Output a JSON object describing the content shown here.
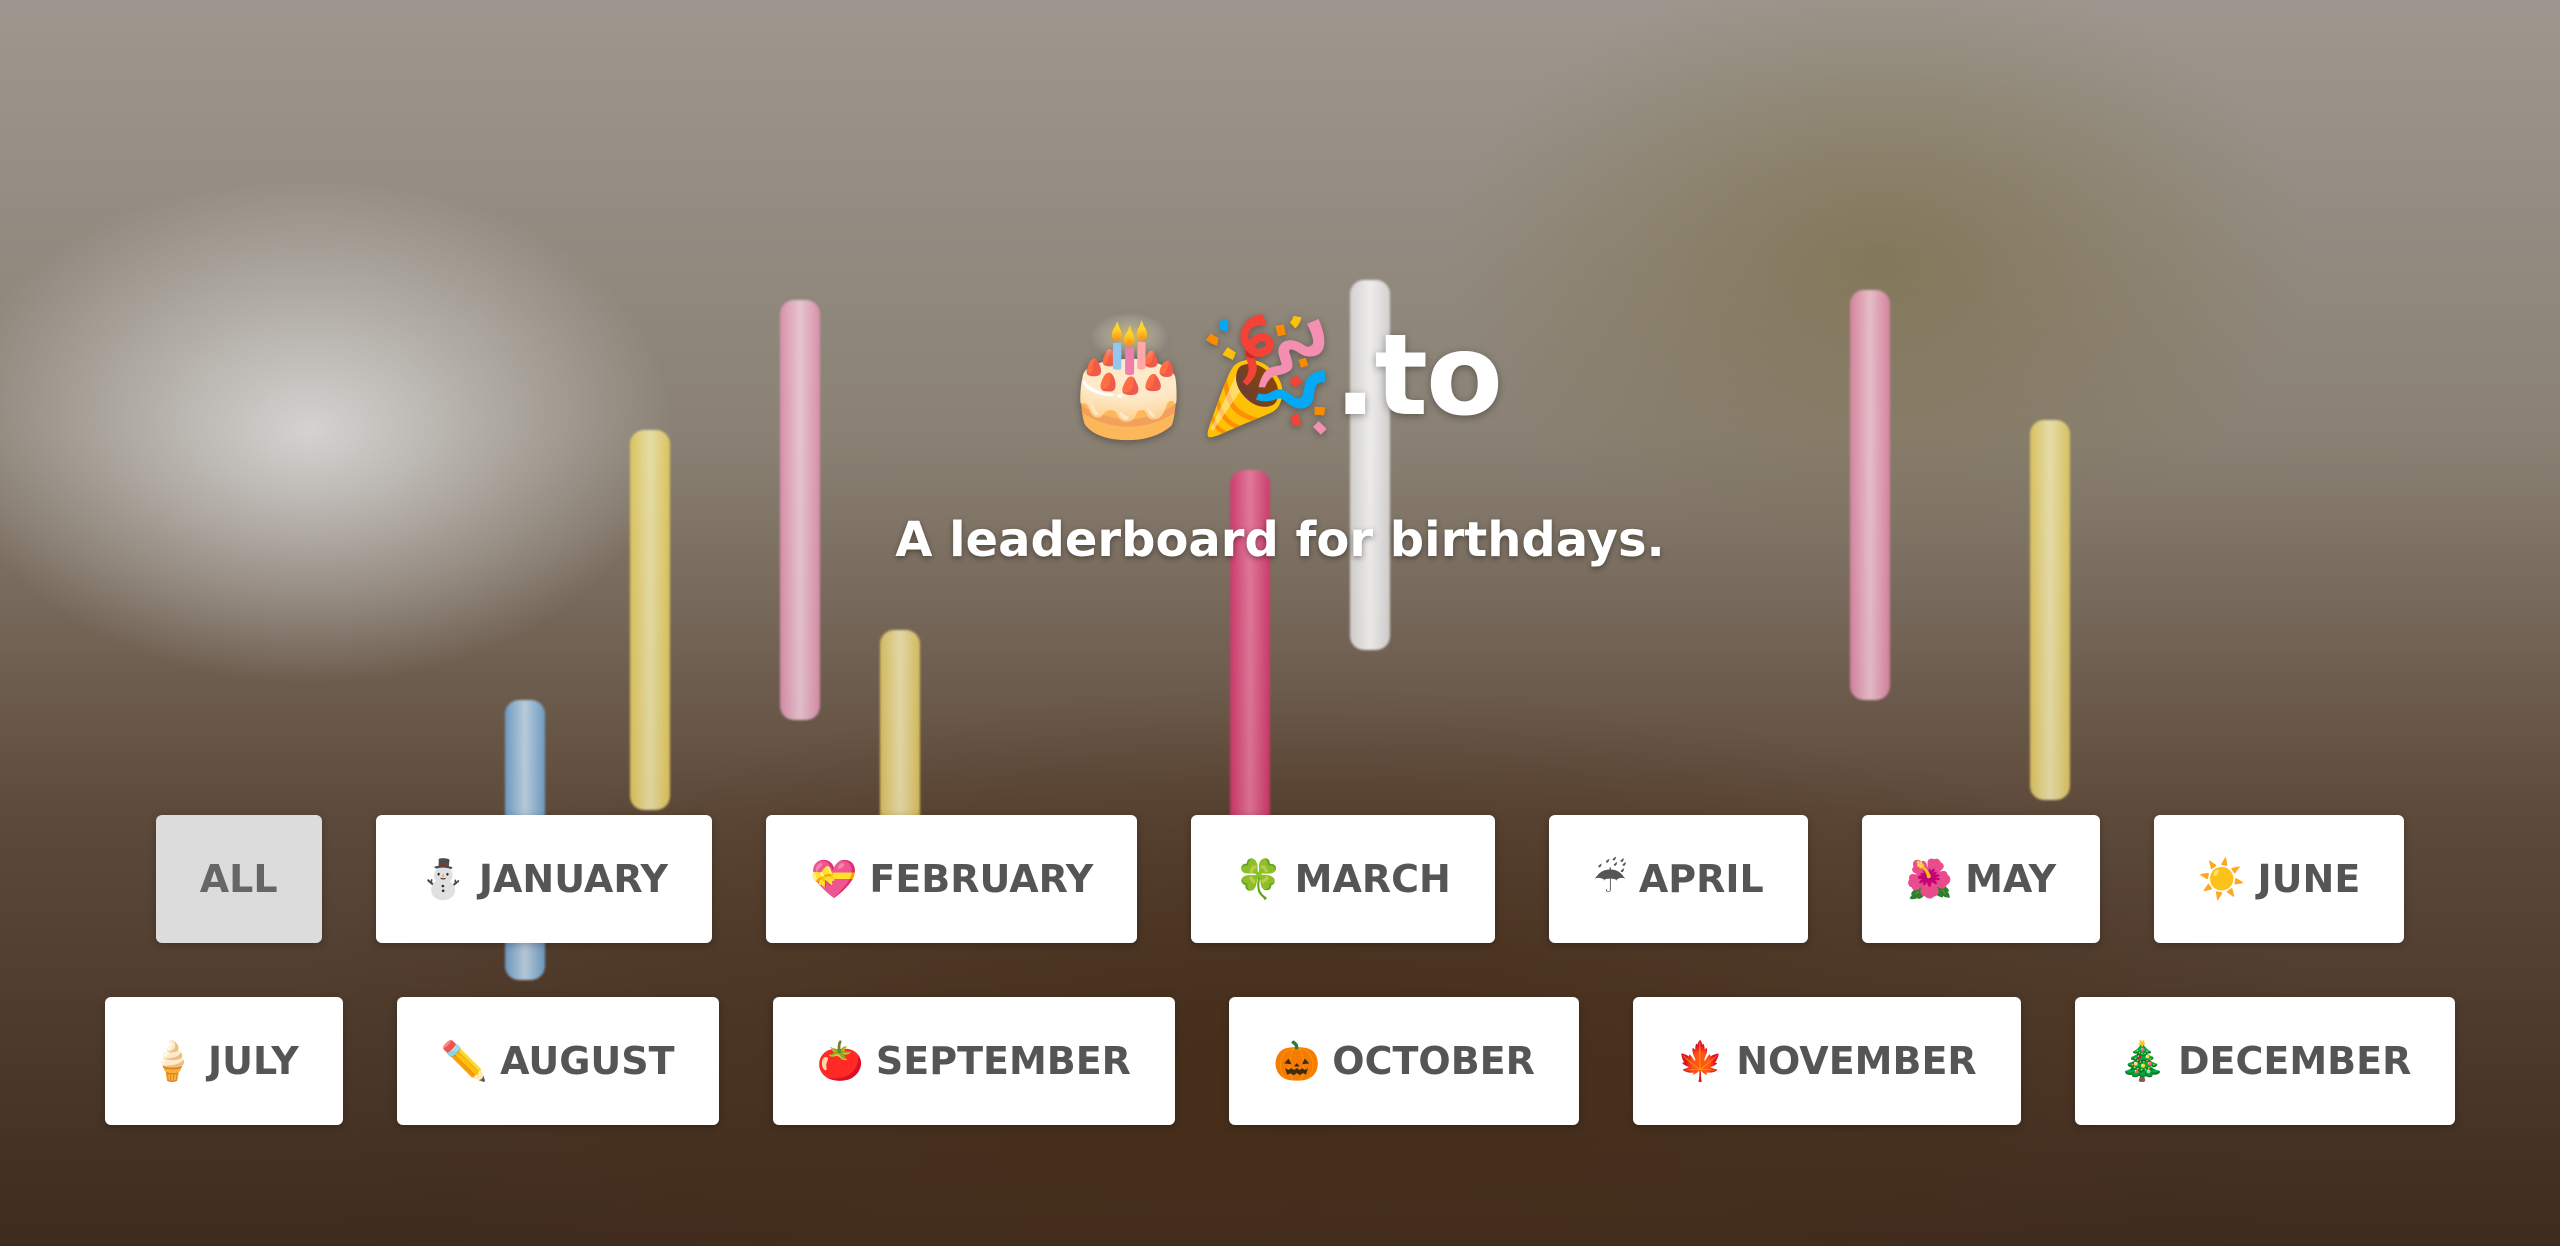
{
  "header": {
    "logo_text": "🎂🎉.to",
    "tagline": "A leaderboard for birthdays."
  },
  "filters": {
    "row1": [
      {
        "icon": "",
        "label": "ALL",
        "active": true
      },
      {
        "icon": "⛄",
        "label": "JANUARY"
      },
      {
        "icon": "💝",
        "label": "FEBRUARY"
      },
      {
        "icon": "🍀",
        "label": "MARCH"
      },
      {
        "icon": "☔",
        "label": "APRIL"
      },
      {
        "icon": "🌺",
        "label": "MAY"
      },
      {
        "icon": "☀️",
        "label": "JUNE"
      }
    ],
    "row2": [
      {
        "icon": "🍦",
        "label": "JULY"
      },
      {
        "icon": "✏️",
        "label": "AUGUST"
      },
      {
        "icon": "🍅",
        "label": "SEPTEMBER"
      },
      {
        "icon": "🎃",
        "label": "OCTOBER"
      },
      {
        "icon": "🍁",
        "label": "NOVEMBER"
      },
      {
        "icon": "🎄",
        "label": "DECEMBER"
      }
    ]
  }
}
